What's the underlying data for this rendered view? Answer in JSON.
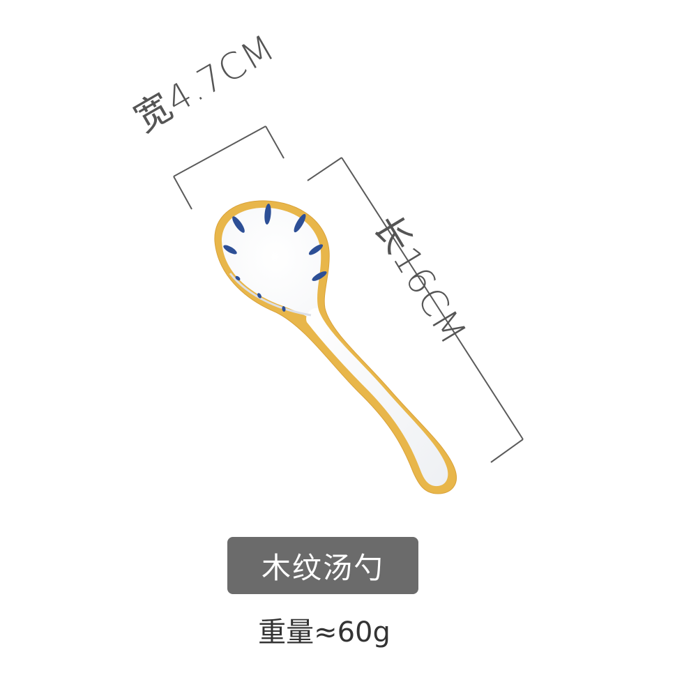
{
  "dimensions": {
    "width_label": "宽4.7CM",
    "length_label": "长16CM"
  },
  "product": {
    "name": "木纹汤勺",
    "weight": "重量≈60g"
  },
  "colors": {
    "background": "#ffffff",
    "dimension_lines": "#5a5a5a",
    "badge": "#6b6b6b",
    "spoon_rim": "#e8b64a",
    "leaf_pattern": "#2d4f96"
  },
  "icons": {
    "spoon": "ceramic-spoon-illustration"
  }
}
